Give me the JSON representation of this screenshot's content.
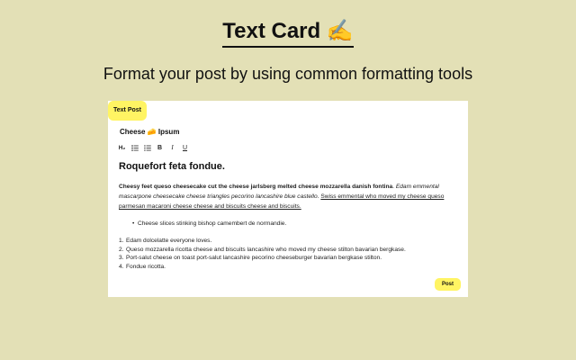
{
  "header": {
    "title": "Text Card",
    "title_icon": "✍️",
    "subtitle": "Format your post by using common formatting tools"
  },
  "card": {
    "tag_label": "Text Post",
    "doc_title": "Cheese 🧀 Ipsum",
    "toolbar": {
      "h2": "H₂",
      "bold": "B",
      "italic": "I",
      "underline": "U"
    },
    "content": {
      "heading": "Roquefort feta fondue.",
      "para_bold": "Cheesy feet queso cheesecake cut the cheese jarlsberg melted cheese mozzarella danish fontina",
      "para_sep1": ". ",
      "para_italic": "Edam emmental mascarpone cheesecake cheese triangles pecorino lancashire blue castello",
      "para_sep2": ". ",
      "para_underline": "Swiss emmental who moved my cheese queso parmesan macaroni cheese cheese and biscuits cheese and biscuits.",
      "bullets": [
        "Cheese slices stinking bishop camembert de normandie."
      ],
      "numbered": [
        "Edam dolcelatte everyone loves.",
        "Queso mozzarella ricotta cheese and biscuits lancashire who moved my cheese stilton bavarian bergkase.",
        "Port-salut cheese on toast port-salut lancashire pecorino cheeseburger bavarian bergkase stilton.",
        "Fondue ricotta."
      ]
    },
    "post_label": "Post"
  },
  "colors": {
    "background": "#e3e0b6",
    "accent": "#fff463",
    "card": "#ffffff"
  }
}
